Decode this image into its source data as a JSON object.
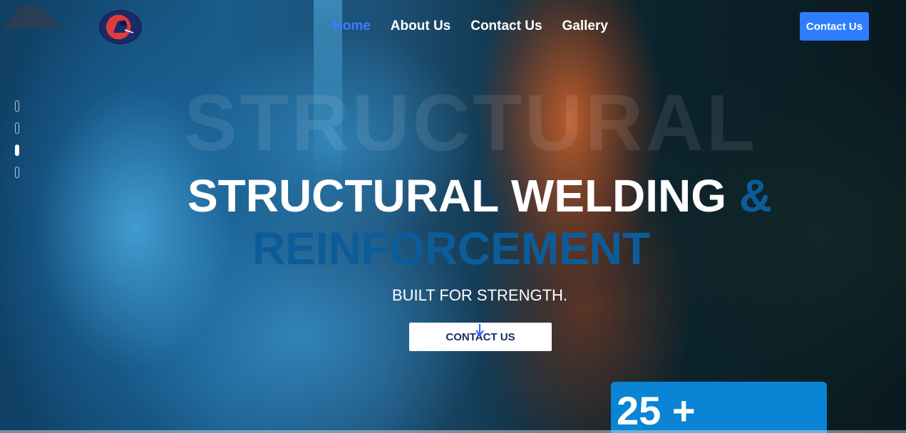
{
  "header": {
    "nav": [
      {
        "label": "Home",
        "active": true
      },
      {
        "label": "About Us",
        "active": false
      },
      {
        "label": "Contact Us",
        "active": false
      },
      {
        "label": "Gallery",
        "active": false
      }
    ],
    "cta_label": "Contact Us"
  },
  "slider": {
    "dot_count": 4,
    "active_index": 2
  },
  "hero": {
    "watermark": "STRUCTURAL",
    "title_main": "STRUCTURAL WELDING",
    "title_amp": "&",
    "title_accent": "REINFORCEMENT",
    "subtitle": "BUILT FOR STRENGTH.",
    "cta_label": "CONTACT US"
  },
  "stat": {
    "value": "25 +"
  },
  "colors": {
    "accent_blue": "#2e7dff",
    "title_accent": "#0d5c9a",
    "stat_bg": "#0a84d4"
  },
  "icons": {
    "logo": "welder-logo-icon",
    "cursor": "mouse-cursor-icon"
  }
}
